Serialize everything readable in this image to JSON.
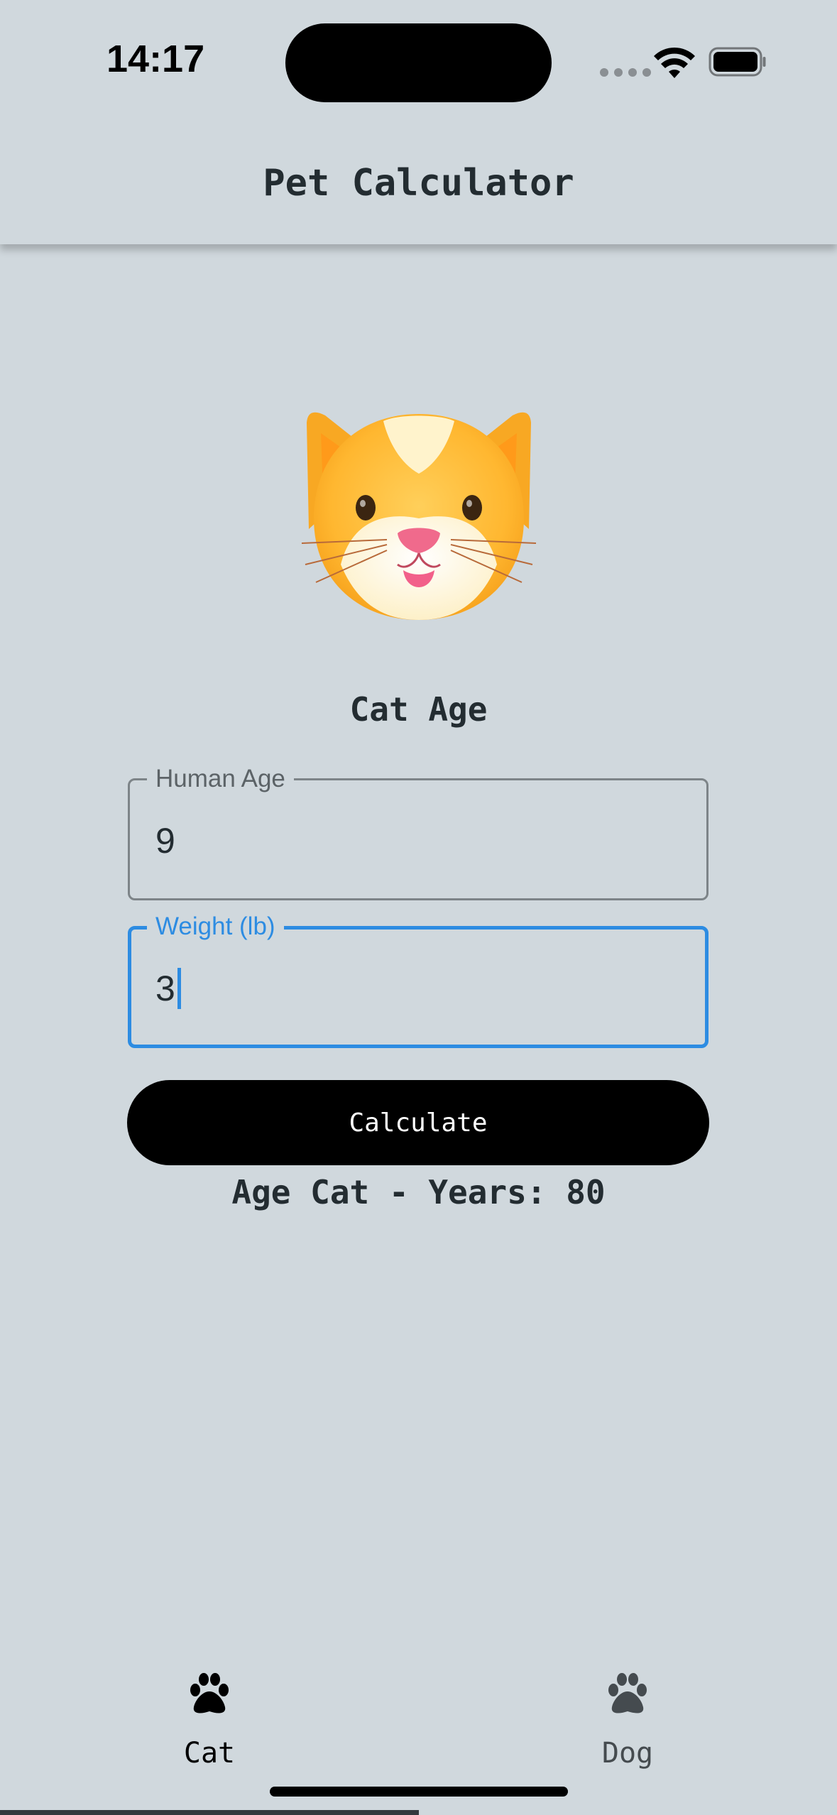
{
  "status_bar": {
    "time": "14:17"
  },
  "app_bar": {
    "title": "Pet Calculator"
  },
  "main": {
    "section_title": "Cat Age",
    "illustration": "cat-face",
    "fields": {
      "human_age": {
        "label": "Human Age",
        "value": "9"
      },
      "weight": {
        "label": "Weight (lb)",
        "value": "3"
      }
    },
    "calculate_label": "Calculate",
    "result": "Age Cat - Years: 80"
  },
  "bottom_nav": {
    "items": [
      {
        "label": "Cat",
        "icon": "paw-icon",
        "selected": true
      },
      {
        "label": "Dog",
        "icon": "paw-icon",
        "selected": false
      }
    ]
  },
  "colors": {
    "background": "#d0d8dd",
    "accent": "#2d8ce2",
    "button": "#000000",
    "text": "#232c31"
  }
}
